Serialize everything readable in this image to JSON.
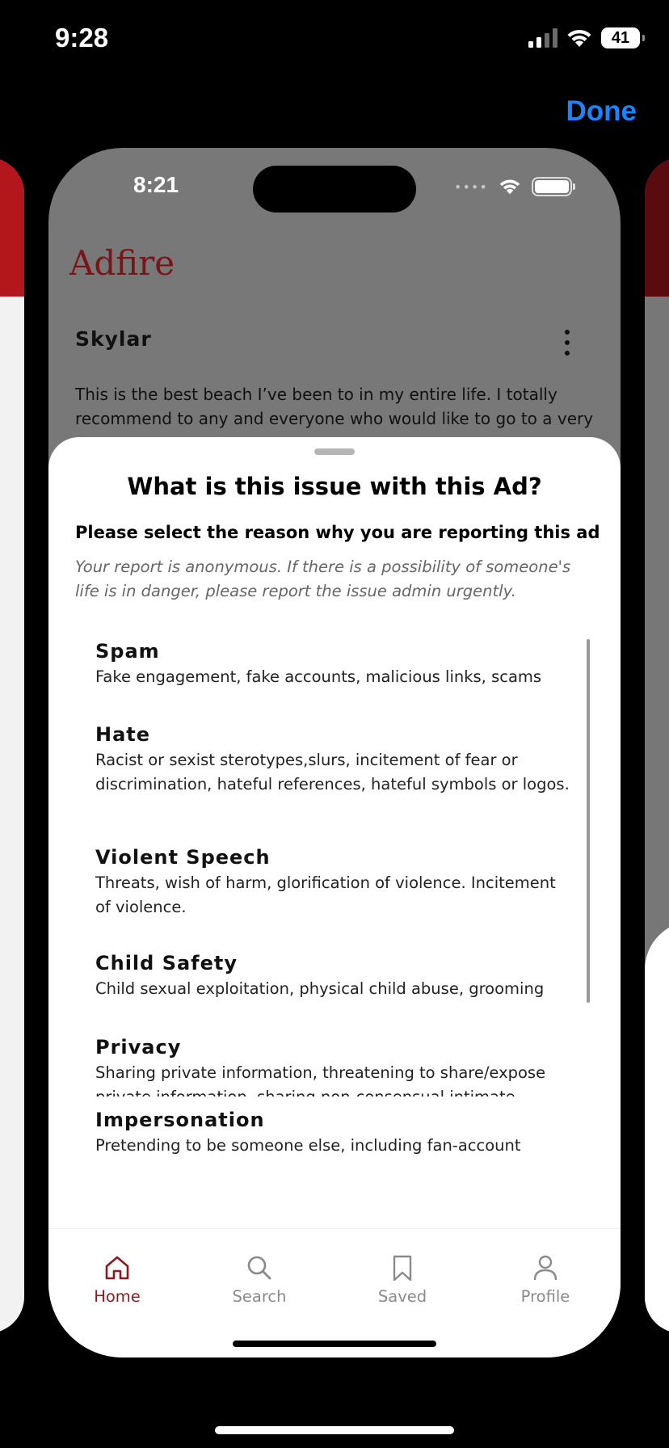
{
  "outer_status": {
    "time": "9:28",
    "battery": "41"
  },
  "top_action": {
    "done_label": "Done"
  },
  "inner_status": {
    "time": "8:21",
    "dots": "••••"
  },
  "app": {
    "brand": "Adfire"
  },
  "post": {
    "author": "Skylar",
    "text": "This is the best beach I’ve been to in my entire life. I totally recommend to any and everyone who would like to go to a very"
  },
  "report_sheet": {
    "title": "What is this issue with this Ad?",
    "subtitle": "Please select the reason why you are reporting this ad",
    "note": "Your report is anonymous. If there is a possibility of someone's life is in danger, please report the issue admin urgently.",
    "reasons": [
      {
        "title": "Spam",
        "description": "Fake engagement, fake accounts, malicious links, scams"
      },
      {
        "title": "Hate",
        "description": "Racist or sexist sterotypes,slurs, incitement of fear or discrimination, hateful references, hateful symbols or logos."
      },
      {
        "title": "Violent Speech",
        "description": "Threats, wish of harm, glorification of violence. Incitement of violence."
      },
      {
        "title": "Child Safety",
        "description": "Child sexual exploitation, physical child abuse, grooming"
      },
      {
        "title": "Privacy",
        "description": "Sharing private information, threatening to share/expose private information, sharing non-consensual intimate images, sharing images of someone that isn't appropriate to be on this platform."
      },
      {
        "title": "Impersonation",
        "description": "Pretending to be someone else, including fan-account"
      }
    ]
  },
  "tabbar": {
    "items": [
      {
        "label": "Home",
        "icon": "home-icon",
        "active": true
      },
      {
        "label": "Search",
        "icon": "search-icon",
        "active": false
      },
      {
        "label": "Saved",
        "icon": "bookmark-icon",
        "active": false
      },
      {
        "label": "Profile",
        "icon": "person-icon",
        "active": false
      }
    ]
  },
  "colors": {
    "brand": "#8c1a1f",
    "link": "#1a84ff",
    "overlay": "#787878"
  }
}
